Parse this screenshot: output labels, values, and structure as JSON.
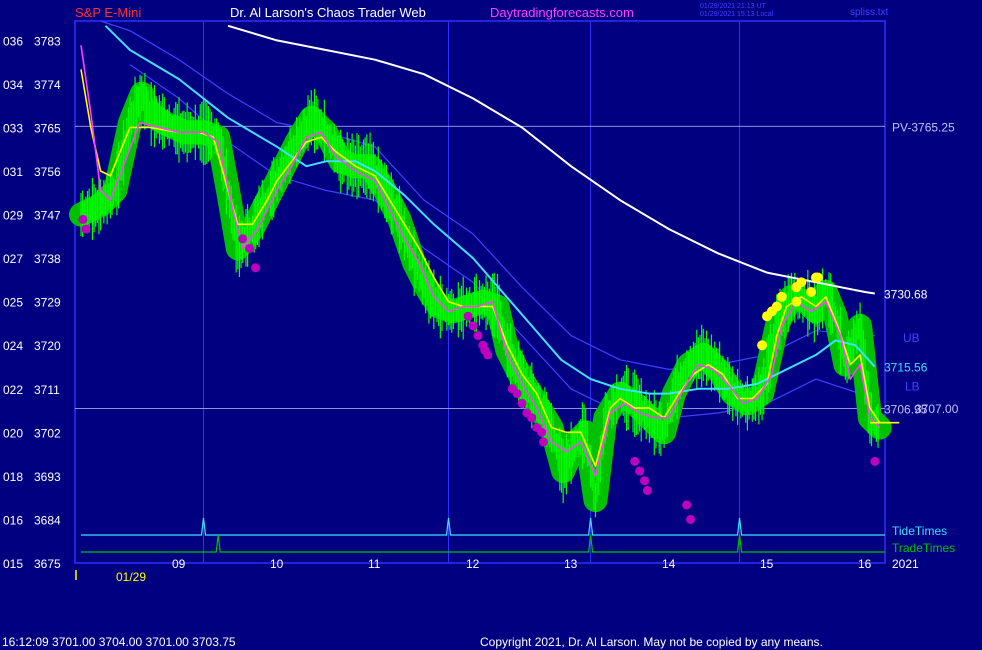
{
  "header": {
    "symbol": "S&P E-Mini",
    "author": "Dr. Al Larson's Chaos Trader Web",
    "site": "Daytradingforecasts.com",
    "timestamp_ut": "01/29/2021 21:13 UT",
    "timestamp_local": "01/29/2021 15:13 Local",
    "filename": "spliss.txt"
  },
  "footer": {
    "quote": "16:12:09  3701.00 3704.00 3701.00 3703.75",
    "copyright": "Copyright 2021, Dr. Al Larson. May not be copied by any means."
  },
  "colors": {
    "background": "#000080",
    "frame": "#2f2fff",
    "price_bars": "#00ff00",
    "halo": "#00c000",
    "fast_avg": "#ffff00",
    "mid_avg": "#ff40ff",
    "ema_cyan": "#40e0ff",
    "bands": "#4040ff",
    "long_avg": "#ffffff",
    "pivot_line": "#c0c0ff",
    "dots_magenta": "#c000c0",
    "dots_yellow": "#ffff00",
    "tide": "#40e0ff",
    "trade": "#00c000"
  },
  "chart_data": {
    "type": "line",
    "y_axis": {
      "ylim": [
        3675,
        3787
      ],
      "ticks": [
        {
          "code": "036",
          "price": 3783
        },
        {
          "code": "034",
          "price": 3774
        },
        {
          "code": "033",
          "price": 3765
        },
        {
          "code": "031",
          "price": 3756
        },
        {
          "code": "029",
          "price": 3747
        },
        {
          "code": "027",
          "price": 3738
        },
        {
          "code": "025",
          "price": 3729
        },
        {
          "code": "024",
          "price": 3720
        },
        {
          "code": "022",
          "price": 3711
        },
        {
          "code": "020",
          "price": 3702
        },
        {
          "code": "018",
          "price": 3693
        },
        {
          "code": "016",
          "price": 3684
        },
        {
          "code": "015",
          "price": 3675
        }
      ]
    },
    "x_axis": {
      "xlim": [
        8.0,
        16.2
      ],
      "hour_ticks": [
        {
          "label": "09",
          "t": 9.0
        },
        {
          "label": "10",
          "t": 10.0
        },
        {
          "label": "11",
          "t": 11.0
        },
        {
          "label": "12",
          "t": 12.0
        },
        {
          "label": "13",
          "t": 13.0
        },
        {
          "label": "14",
          "t": 14.0
        },
        {
          "label": "15",
          "t": 15.0
        },
        {
          "label": "16",
          "t": 16.0
        }
      ],
      "date_label": "01/29",
      "year_label": "2021",
      "vertical_time_lines": [
        9.25,
        11.75,
        13.2,
        14.72
      ]
    },
    "price_levels": [
      {
        "label": "PV-3765.25",
        "price": 3765.25
      },
      {
        "label": "3706.95",
        "price": 3706.95
      },
      {
        "label": "3707.00",
        "price": 3707.0
      }
    ],
    "band_labels": [
      {
        "label": "UB",
        "price": 3721.5
      },
      {
        "label": "LB",
        "price": 3711.5
      }
    ],
    "series": [
      {
        "name": "3730.68",
        "color": "#ffffff",
        "points": [
          [
            9.5,
            3786
          ],
          [
            10.0,
            3783
          ],
          [
            10.5,
            3781
          ],
          [
            11.0,
            3779
          ],
          [
            11.5,
            3776
          ],
          [
            12.0,
            3771
          ],
          [
            12.5,
            3765
          ],
          [
            13.0,
            3757
          ],
          [
            13.5,
            3750
          ],
          [
            14.0,
            3744
          ],
          [
            14.5,
            3739
          ],
          [
            15.0,
            3735
          ],
          [
            15.5,
            3733
          ],
          [
            16.0,
            3731
          ],
          [
            16.1,
            3730.68
          ]
        ]
      },
      {
        "name": "3715.56",
        "color": "#40e0ff",
        "points": [
          [
            8.25,
            3786
          ],
          [
            8.5,
            3781
          ],
          [
            9.0,
            3775
          ],
          [
            9.5,
            3767
          ],
          [
            10.0,
            3761
          ],
          [
            10.3,
            3757
          ],
          [
            10.5,
            3758
          ],
          [
            10.8,
            3758
          ],
          [
            11.0,
            3756
          ],
          [
            11.3,
            3751
          ],
          [
            11.6,
            3745
          ],
          [
            12.0,
            3738
          ],
          [
            12.3,
            3731
          ],
          [
            12.6,
            3724
          ],
          [
            12.9,
            3717
          ],
          [
            13.2,
            3713
          ],
          [
            13.5,
            3711
          ],
          [
            13.8,
            3710
          ],
          [
            14.0,
            3710
          ],
          [
            14.3,
            3711
          ],
          [
            14.6,
            3711
          ],
          [
            14.9,
            3712
          ],
          [
            15.2,
            3715
          ],
          [
            15.5,
            3718
          ],
          [
            15.7,
            3721
          ],
          [
            15.9,
            3720
          ],
          [
            16.1,
            3715.56
          ]
        ]
      },
      {
        "name": "UB",
        "color": "#4040ff",
        "points": [
          [
            8.2,
            3787
          ],
          [
            8.5,
            3785
          ],
          [
            9.0,
            3779
          ],
          [
            9.5,
            3772
          ],
          [
            10.0,
            3766
          ],
          [
            10.5,
            3764
          ],
          [
            11.0,
            3761
          ],
          [
            11.5,
            3750
          ],
          [
            12.0,
            3743
          ],
          [
            12.5,
            3732
          ],
          [
            13.0,
            3722
          ],
          [
            13.5,
            3717
          ],
          [
            14.0,
            3715
          ],
          [
            14.5,
            3716
          ],
          [
            15.0,
            3718
          ],
          [
            15.5,
            3723
          ],
          [
            16.1,
            3722
          ]
        ]
      },
      {
        "name": "LB",
        "color": "#4040ff",
        "points": [
          [
            8.5,
            3778
          ],
          [
            9.0,
            3771
          ],
          [
            9.5,
            3762
          ],
          [
            10.0,
            3755
          ],
          [
            10.5,
            3752
          ],
          [
            11.0,
            3750
          ],
          [
            11.5,
            3740
          ],
          [
            12.0,
            3733
          ],
          [
            12.5,
            3722
          ],
          [
            13.0,
            3711
          ],
          [
            13.5,
            3706
          ],
          [
            14.0,
            3705
          ],
          [
            14.5,
            3706
          ],
          [
            15.0,
            3708
          ],
          [
            15.5,
            3713
          ],
          [
            16.1,
            3709
          ]
        ]
      },
      {
        "name": "",
        "color": "#ffff00",
        "points": [
          [
            8.0,
            3777
          ],
          [
            8.1,
            3765
          ],
          [
            8.2,
            3756
          ],
          [
            8.3,
            3755
          ],
          [
            8.4,
            3760
          ],
          [
            8.5,
            3765
          ],
          [
            8.7,
            3765
          ],
          [
            9.0,
            3764
          ],
          [
            9.2,
            3764
          ],
          [
            9.35,
            3763
          ],
          [
            9.5,
            3752
          ],
          [
            9.6,
            3745
          ],
          [
            9.75,
            3745
          ],
          [
            9.9,
            3750
          ],
          [
            10.0,
            3754
          ],
          [
            10.15,
            3758
          ],
          [
            10.3,
            3762
          ],
          [
            10.45,
            3763
          ],
          [
            10.6,
            3760
          ],
          [
            10.8,
            3757
          ],
          [
            11.0,
            3755
          ],
          [
            11.15,
            3750
          ],
          [
            11.3,
            3745
          ],
          [
            11.45,
            3740
          ],
          [
            11.6,
            3734
          ],
          [
            11.75,
            3729
          ],
          [
            11.9,
            3728
          ],
          [
            12.05,
            3728
          ],
          [
            12.2,
            3728
          ],
          [
            12.35,
            3720
          ],
          [
            12.5,
            3714
          ],
          [
            12.65,
            3710
          ],
          [
            12.8,
            3703
          ],
          [
            12.95,
            3702
          ],
          [
            13.1,
            3702
          ],
          [
            13.25,
            3695
          ],
          [
            13.4,
            3707
          ],
          [
            13.5,
            3709
          ],
          [
            13.65,
            3707
          ],
          [
            13.8,
            3707
          ],
          [
            13.95,
            3705
          ],
          [
            14.1,
            3710
          ],
          [
            14.25,
            3714
          ],
          [
            14.4,
            3716
          ],
          [
            14.55,
            3714
          ],
          [
            14.7,
            3709
          ],
          [
            14.85,
            3709
          ],
          [
            15.0,
            3712
          ],
          [
            15.1,
            3722
          ],
          [
            15.2,
            3728
          ],
          [
            15.35,
            3730
          ],
          [
            15.5,
            3728
          ],
          [
            15.6,
            3730
          ],
          [
            15.72,
            3724
          ],
          [
            15.85,
            3716
          ],
          [
            15.95,
            3718
          ],
          [
            16.05,
            3707
          ],
          [
            16.15,
            3704
          ],
          [
            16.2,
            3704
          ]
        ]
      },
      {
        "name": "",
        "color": "#ff40ff",
        "points": [
          [
            8.0,
            3782
          ],
          [
            8.1,
            3768
          ],
          [
            8.2,
            3752
          ],
          [
            8.3,
            3750
          ],
          [
            8.45,
            3758
          ],
          [
            8.6,
            3766
          ],
          [
            8.8,
            3765
          ],
          [
            9.0,
            3764
          ],
          [
            9.25,
            3764
          ],
          [
            9.4,
            3762
          ],
          [
            9.55,
            3748
          ],
          [
            9.65,
            3740
          ],
          [
            9.8,
            3744
          ],
          [
            10.0,
            3752
          ],
          [
            10.15,
            3757
          ],
          [
            10.3,
            3763
          ],
          [
            10.45,
            3764
          ],
          [
            10.6,
            3759
          ],
          [
            10.8,
            3756
          ],
          [
            11.0,
            3754
          ],
          [
            11.15,
            3748
          ],
          [
            11.3,
            3742
          ],
          [
            11.45,
            3737
          ],
          [
            11.6,
            3730
          ],
          [
            11.75,
            3727
          ],
          [
            11.9,
            3728
          ],
          [
            12.05,
            3728
          ],
          [
            12.2,
            3729
          ],
          [
            12.35,
            3718
          ],
          [
            12.5,
            3712
          ],
          [
            12.65,
            3707
          ],
          [
            12.8,
            3700
          ],
          [
            12.95,
            3698
          ],
          [
            13.1,
            3700
          ],
          [
            13.25,
            3693
          ],
          [
            13.4,
            3706
          ],
          [
            13.55,
            3708
          ],
          [
            13.7,
            3706
          ],
          [
            13.85,
            3705
          ],
          [
            14.0,
            3705
          ],
          [
            14.15,
            3711
          ],
          [
            14.3,
            3716
          ],
          [
            14.45,
            3715
          ],
          [
            14.6,
            3712
          ],
          [
            14.75,
            3708
          ],
          [
            14.9,
            3709
          ],
          [
            15.05,
            3714
          ],
          [
            15.15,
            3724
          ],
          [
            15.3,
            3729
          ],
          [
            15.45,
            3727
          ],
          [
            15.6,
            3729
          ],
          [
            15.75,
            3722
          ],
          [
            15.85,
            3713
          ],
          [
            15.95,
            3716
          ],
          [
            16.05,
            3705
          ],
          [
            16.15,
            3703
          ]
        ]
      }
    ],
    "price_bar_path": [
      [
        8.0,
        3747
      ],
      [
        8.2,
        3749
      ],
      [
        8.35,
        3752
      ],
      [
        8.5,
        3766
      ],
      [
        8.62,
        3772
      ],
      [
        8.7,
        3768
      ],
      [
        8.85,
        3766
      ],
      [
        9.05,
        3764
      ],
      [
        9.25,
        3764
      ],
      [
        9.4,
        3763
      ],
      [
        9.5,
        3752
      ],
      [
        9.6,
        3740
      ],
      [
        9.75,
        3744
      ],
      [
        9.9,
        3750
      ],
      [
        10.05,
        3756
      ],
      [
        10.2,
        3762
      ],
      [
        10.35,
        3767
      ],
      [
        10.5,
        3764
      ],
      [
        10.65,
        3758
      ],
      [
        10.8,
        3757
      ],
      [
        10.95,
        3757
      ],
      [
        11.1,
        3752
      ],
      [
        11.25,
        3746
      ],
      [
        11.4,
        3737
      ],
      [
        11.55,
        3731
      ],
      [
        11.65,
        3728
      ],
      [
        11.8,
        3727
      ],
      [
        11.95,
        3728
      ],
      [
        12.1,
        3729
      ],
      [
        12.25,
        3728
      ],
      [
        12.35,
        3719
      ],
      [
        12.5,
        3713
      ],
      [
        12.65,
        3708
      ],
      [
        12.8,
        3703
      ],
      [
        12.92,
        3694
      ],
      [
        13.05,
        3700
      ],
      [
        13.15,
        3702
      ],
      [
        13.25,
        3688
      ],
      [
        13.35,
        3705
      ],
      [
        13.5,
        3710
      ],
      [
        13.65,
        3708
      ],
      [
        13.8,
        3705
      ],
      [
        13.95,
        3702
      ],
      [
        14.05,
        3710
      ],
      [
        14.2,
        3716
      ],
      [
        14.35,
        3718
      ],
      [
        14.5,
        3715
      ],
      [
        14.65,
        3710
      ],
      [
        14.8,
        3708
      ],
      [
        14.95,
        3710
      ],
      [
        15.1,
        3724
      ],
      [
        15.25,
        3730
      ],
      [
        15.4,
        3729
      ],
      [
        15.5,
        3727
      ],
      [
        15.6,
        3731
      ],
      [
        15.7,
        3726
      ],
      [
        15.8,
        3716
      ],
      [
        15.9,
        3722
      ],
      [
        15.95,
        3724
      ],
      [
        16.05,
        3705
      ],
      [
        16.15,
        3703
      ]
    ],
    "magenta_dots": [
      [
        8.02,
        3746
      ],
      [
        8.05,
        3744
      ],
      [
        9.65,
        3742
      ],
      [
        9.72,
        3740
      ],
      [
        9.78,
        3736
      ],
      [
        11.95,
        3726
      ],
      [
        12.0,
        3724
      ],
      [
        12.05,
        3722
      ],
      [
        12.1,
        3720
      ],
      [
        12.12,
        3719
      ],
      [
        12.15,
        3718
      ],
      [
        12.4,
        3711
      ],
      [
        12.45,
        3710
      ],
      [
        12.5,
        3708
      ],
      [
        12.55,
        3706
      ],
      [
        12.6,
        3705
      ],
      [
        12.65,
        3703
      ],
      [
        12.7,
        3702
      ],
      [
        12.72,
        3700
      ],
      [
        13.65,
        3696
      ],
      [
        13.7,
        3694
      ],
      [
        13.75,
        3692
      ],
      [
        13.78,
        3690
      ],
      [
        14.18,
        3687
      ],
      [
        14.22,
        3684
      ],
      [
        16.1,
        3696
      ]
    ],
    "yellow_dots": [
      [
        14.95,
        3720
      ],
      [
        15.0,
        3726
      ],
      [
        15.05,
        3727
      ],
      [
        15.1,
        3728
      ],
      [
        15.15,
        3730
      ],
      [
        15.3,
        3732
      ],
      [
        15.35,
        3733
      ],
      [
        15.5,
        3734
      ],
      [
        15.52,
        3734
      ],
      [
        15.3,
        3729
      ],
      [
        15.45,
        3731
      ]
    ],
    "markers": [
      {
        "name": "TideTimes",
        "color": "#40e0ff",
        "times": [
          9.25,
          11.75,
          13.2,
          14.72
        ]
      },
      {
        "name": "TradeTimes",
        "color": "#00c000",
        "times": [
          9.4,
          13.2,
          14.72
        ]
      }
    ],
    "last_value_marker": 3704
  }
}
